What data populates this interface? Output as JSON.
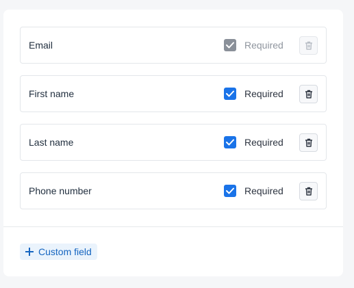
{
  "fields": [
    {
      "name": "Email",
      "required_label": "Required",
      "required": true,
      "disabled": true
    },
    {
      "name": "First name",
      "required_label": "Required",
      "required": true,
      "disabled": false
    },
    {
      "name": "Last name",
      "required_label": "Required",
      "required": true,
      "disabled": false
    },
    {
      "name": "Phone number",
      "required_label": "Required",
      "required": true,
      "disabled": false
    }
  ],
  "custom_field_button": {
    "label": "Custom field"
  },
  "colors": {
    "accent": "#1a73e8",
    "disabled_checkbox": "#8a9099",
    "link": "#1565c0",
    "button_bg": "#eaf3fc"
  },
  "icons": {
    "checkbox": "check-icon",
    "delete": "trash-icon",
    "add": "plus-icon"
  }
}
